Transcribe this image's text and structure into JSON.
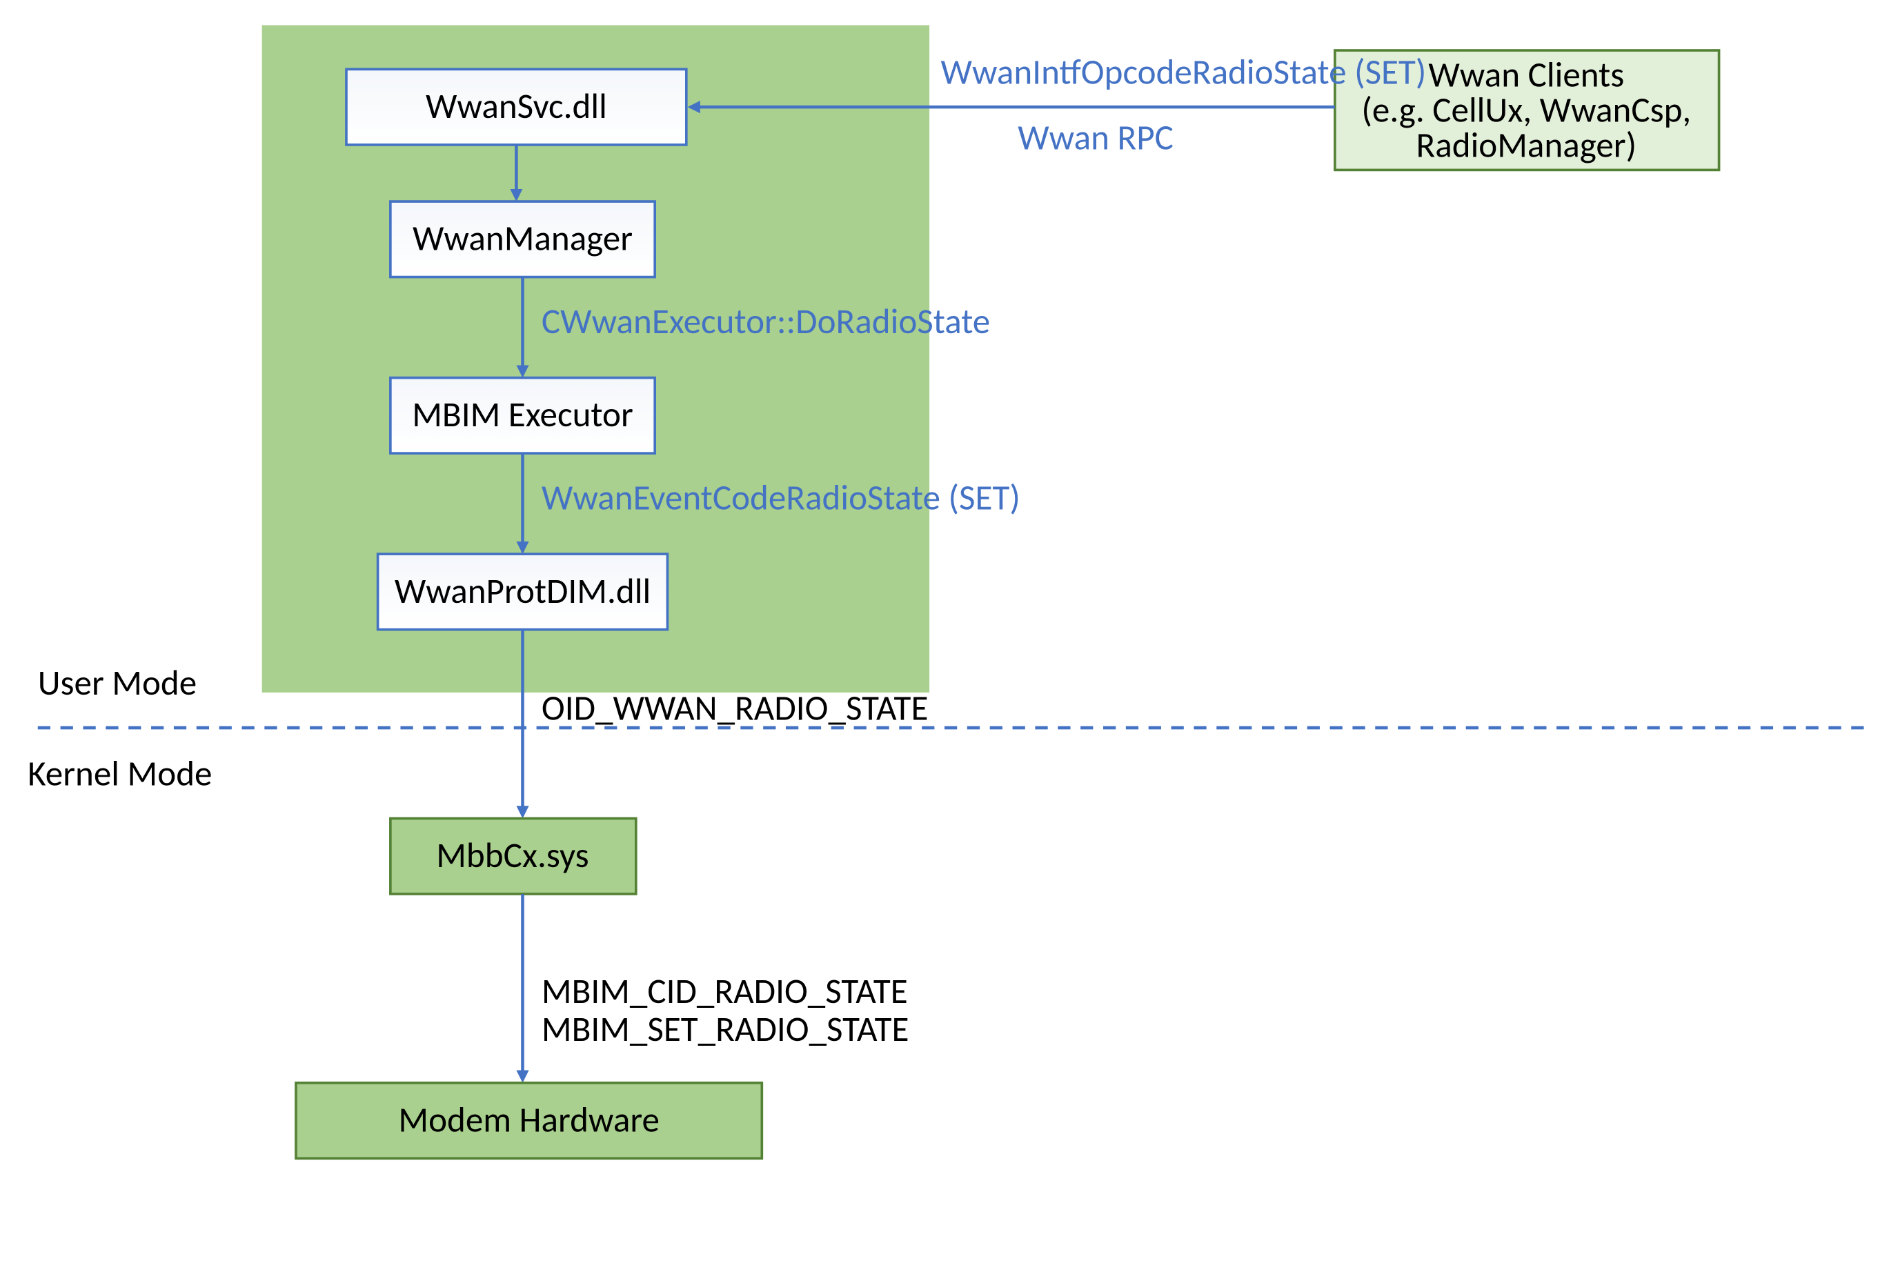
{
  "boxes": {
    "wwansvc": "WwanSvc.dll",
    "wwanmanager": "WwanManager",
    "mbimexec": "MBIM Executor",
    "wwanprotdim": "WwanProtDIM.dll",
    "mbbcx": "MbbCx.sys",
    "modem": "Modem Hardware",
    "clients_l1": "Wwan Clients",
    "clients_l2": "(e.g. CellUx, WwanCsp,",
    "clients_l3": "RadioManager)"
  },
  "labels": {
    "opcode": "WwanIntfOpcodeRadioState (SET)",
    "rpc": "Wwan RPC",
    "doRadio": "CWwanExecutor::DoRadioState",
    "eventCode": "WwanEventCodeRadioState (SET)",
    "oid": "OID_WWAN_RADIO_STATE",
    "mbim_l1": "MBIM_CID_RADIO_STATE",
    "mbim_l2": "MBIM_SET_RADIO_STATE",
    "userMode": "User Mode",
    "kernelMode": "Kernel Mode"
  },
  "colors": {
    "blue": "#4472c4",
    "green": "#a9d08e",
    "greenDark": "#548235",
    "greenLight": "#e2efd9"
  }
}
